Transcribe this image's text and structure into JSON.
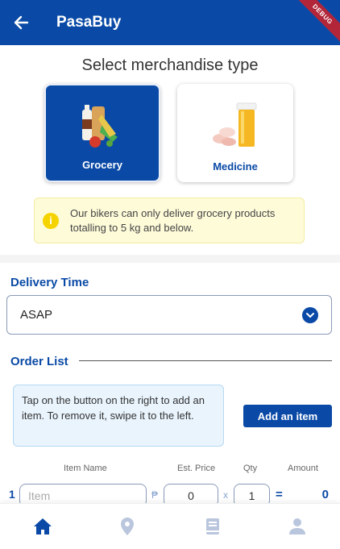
{
  "appbar": {
    "title": "PasaBuy",
    "debug_label": "DEBUG"
  },
  "merchandise": {
    "heading": "Select merchandise type",
    "options": [
      {
        "label": "Grocery",
        "selected": true
      },
      {
        "label": "Medicine",
        "selected": false
      }
    ],
    "notice": "Our bikers can only deliver grocery products totalling to 5 kg and below."
  },
  "delivery": {
    "label": "Delivery Time",
    "value": "ASAP"
  },
  "order": {
    "label": "Order List",
    "help": "Tap on the button on the right to add an item. To remove it, swipe it to the left.",
    "add_button": "Add an item",
    "columns": {
      "item_name": "Item Name",
      "est_price": "Est. Price",
      "qty": "Qty",
      "amount": "Amount"
    },
    "rows": [
      {
        "index": "1",
        "item_placeholder": "Item",
        "currency": "₱",
        "price": "0",
        "times": "x",
        "qty": "1",
        "equals": "=",
        "amount": "0"
      }
    ]
  },
  "nav": [
    {
      "name": "home-icon",
      "active": true
    },
    {
      "name": "location-icon",
      "active": false
    },
    {
      "name": "book-icon",
      "active": false
    },
    {
      "name": "person-icon",
      "active": false
    }
  ],
  "colors": {
    "primary": "#0a4aa6",
    "inactive": "#b9c6dd"
  }
}
